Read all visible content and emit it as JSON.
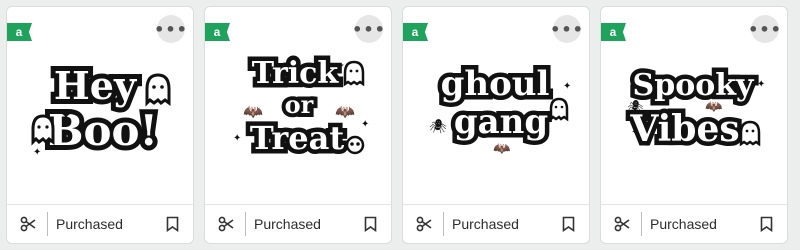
{
  "colors": {
    "badge": "#1fa35c",
    "background": "#eceded",
    "card": "#ffffff"
  },
  "cards": [
    {
      "badge": "a",
      "art_lines": [
        "Hey",
        "Boo!"
      ],
      "status": "Purchased"
    },
    {
      "badge": "a",
      "art_lines": [
        "Trick",
        "or",
        "Treat"
      ],
      "status": "Purchased"
    },
    {
      "badge": "a",
      "art_lines": [
        "ghoul",
        "gang"
      ],
      "status": "Purchased"
    },
    {
      "badge": "a",
      "art_lines": [
        "Spooky",
        "Vibes"
      ],
      "status": "Purchased"
    }
  ],
  "icons": {
    "more": "more-options-icon",
    "cut": "scissors-icon",
    "save": "bookmark-icon"
  }
}
